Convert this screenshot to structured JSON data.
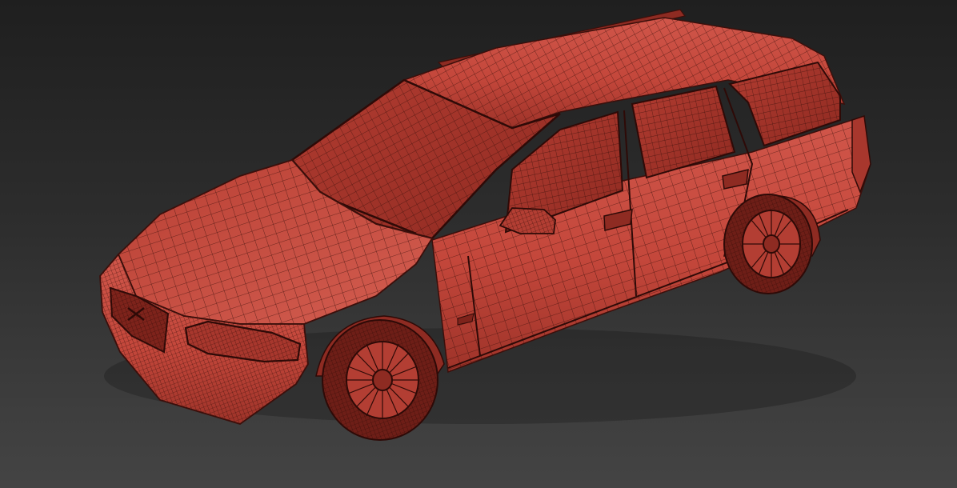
{
  "viewport": {
    "subject": "wireframe-station-wagon",
    "colors": {
      "background_top": "#1f1f1f",
      "background_bottom": "#444444",
      "body_paint": "#c4473b",
      "body_shadow": "#8e2b22",
      "body_highlight": "#d9665a",
      "wire": "#3b0f0b",
      "glass": "#9c3027",
      "tire": "#2b1512"
    }
  }
}
